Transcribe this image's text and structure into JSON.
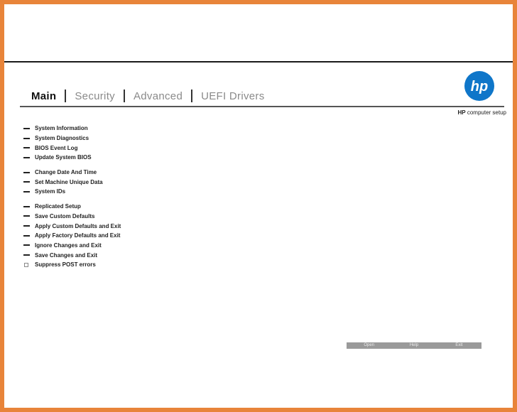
{
  "tabs": [
    {
      "label": "Main",
      "active": true
    },
    {
      "label": "Security",
      "active": false
    },
    {
      "label": "Advanced",
      "active": false
    },
    {
      "label": "UEFI Drivers",
      "active": false
    }
  ],
  "logo": {
    "text": "hp",
    "color": "#0f76c9"
  },
  "brand": {
    "bold": "HP",
    "rest": " computer setup"
  },
  "menu": {
    "group1": [
      "System Information",
      "System Diagnostics",
      "BIOS Event Log",
      "Update System BIOS"
    ],
    "group2": [
      "Change Date And Time",
      "Set Machine Unique Data",
      "System IDs"
    ],
    "group3": [
      "Replicated Setup",
      "Save Custom Defaults",
      "Apply Custom Defaults and Exit",
      "Apply Factory Defaults and Exit",
      "Ignore Changes and Exit",
      "Save Changes and Exit"
    ],
    "checkbox_item": {
      "label": "Suppress POST errors",
      "checked": false
    }
  },
  "bottom_buttons": [
    "Open",
    "Help",
    "Exit"
  ],
  "colors": {
    "frame": "#e8843a",
    "accent": "#0f76c9",
    "bottom_bar": "#9a9a9a"
  }
}
